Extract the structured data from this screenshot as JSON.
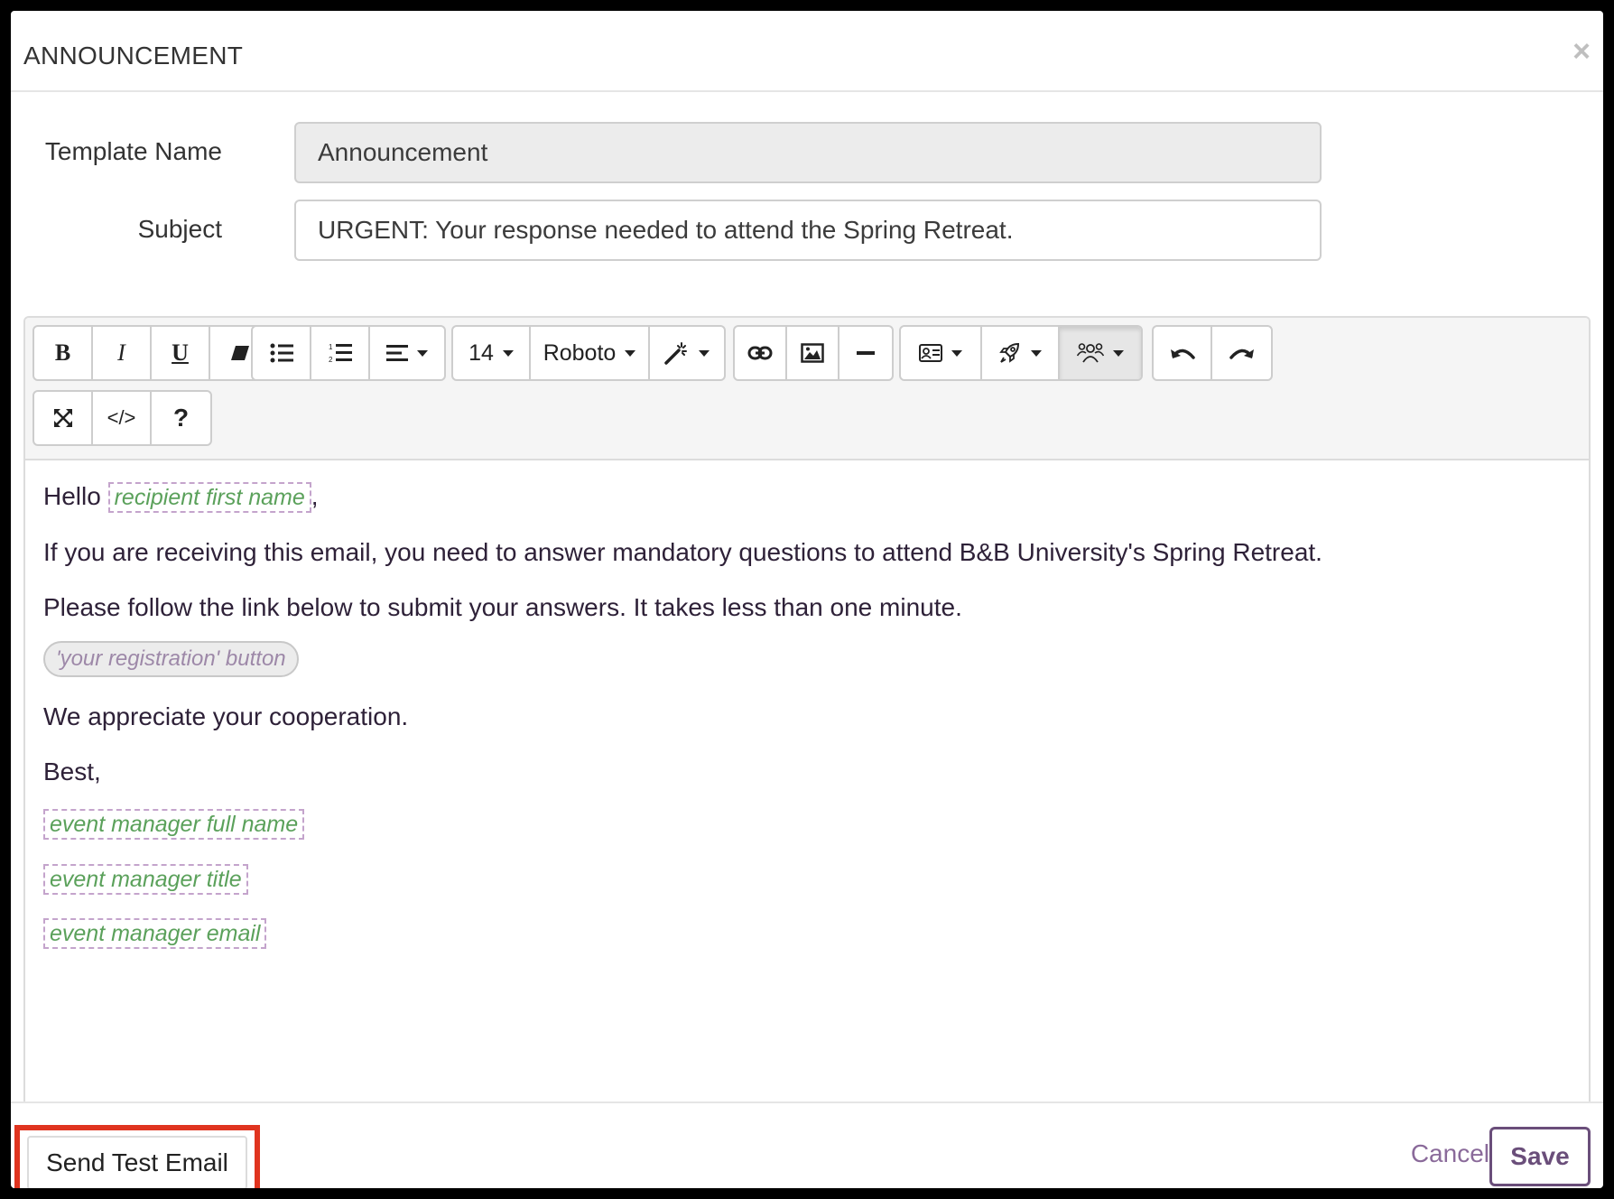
{
  "modal": {
    "title": "ANNOUNCEMENT",
    "close_symbol": "×"
  },
  "form": {
    "template_name_label": "Template Name",
    "template_name_value": "Announcement",
    "subject_label": "Subject",
    "subject_value": "URGENT: Your response needed to attend the Spring Retreat."
  },
  "toolbar": {
    "bold": "B",
    "italic": "I",
    "underline": "U",
    "font_size": "14",
    "font_family": "Roboto",
    "code_view": "</>",
    "help": "?",
    "icons": [
      "bold-icon",
      "italic-icon",
      "underline-icon",
      "eraser-icon",
      "unordered-list-icon",
      "ordered-list-icon",
      "align-icon",
      "font-size-dropdown",
      "font-family-dropdown",
      "magic-wand-icon",
      "link-icon",
      "image-icon",
      "horizontal-rule-icon",
      "id-card-icon",
      "rocket-icon",
      "people-icon",
      "undo-icon",
      "redo-icon",
      "fullscreen-icon",
      "code-view-icon",
      "help-icon"
    ]
  },
  "body": {
    "greeting": "Hello",
    "recipient_chip": "recipient first name",
    "greeting_comma": ",",
    "paragraph1": "If you are receiving this email, you need to answer mandatory questions to attend B&B University's Spring Retreat.",
    "paragraph2": "Please follow the link below to submit your answers. It takes less than one minute.",
    "registration_pill": "'your registration' button",
    "paragraph3": "We appreciate your cooperation.",
    "signoff": "Best,",
    "manager_name_chip": "event manager full name",
    "manager_title_chip": "event manager title",
    "manager_email_chip": "event manager email"
  },
  "footer": {
    "send_test_label": "Send Test Email",
    "cancel_label": "Cancel",
    "save_label": "Save"
  },
  "colors": {
    "accent": "#6a4e7a",
    "highlight_border": "#e0341f",
    "chip_text": "#5ba15b"
  }
}
